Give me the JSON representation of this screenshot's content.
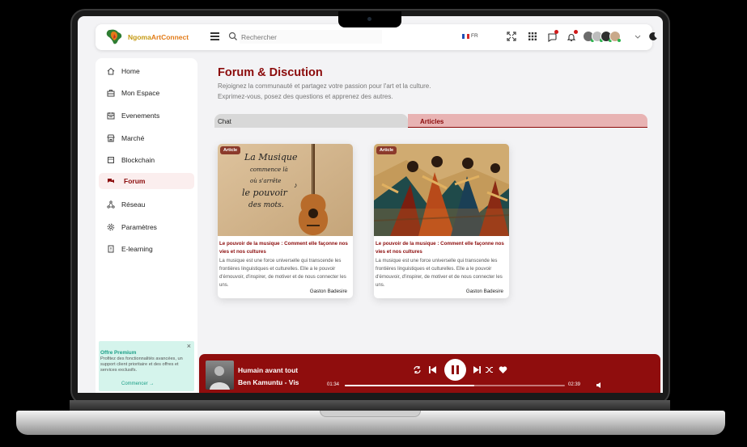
{
  "header": {
    "brand_part1": "Ngoma",
    "brand_part2": "ArtConnect",
    "search_placeholder": "Rechercher",
    "language": "FR"
  },
  "sidebar": {
    "items": [
      {
        "label": "Home",
        "icon": "home-icon"
      },
      {
        "label": "Mon Espace",
        "icon": "briefcase-icon"
      },
      {
        "label": "Evenements",
        "icon": "calendar-icon"
      },
      {
        "label": "Marché",
        "icon": "store-icon"
      },
      {
        "label": "Blockchain",
        "icon": "cube-icon"
      },
      {
        "label": "Forum",
        "icon": "chat-bubbles-icon"
      },
      {
        "label": "Réseau",
        "icon": "network-icon"
      },
      {
        "label": "Paramètres",
        "icon": "gear-icon"
      },
      {
        "label": "E-learning",
        "icon": "book-icon"
      }
    ],
    "active": "Forum",
    "premium": {
      "title": "Offre Premium",
      "description": "Profitez des fonctionnalités avancées, un support client prioritaire et des offres et services exclusifs.",
      "cta": "Commencer →"
    }
  },
  "main": {
    "title": "Forum & Discution",
    "subtitle_line1": "Rejoignez la communauté et partagez votre passion pour l'art et la culture.",
    "subtitle_line2": "Exprimez-vous, posez des questions et apprenez des autres.",
    "tabs": [
      {
        "label": "Chat"
      },
      {
        "label": "Articles"
      }
    ],
    "active_tab": "Articles",
    "cards": [
      {
        "tag": "Article",
        "title": "Le pouvoir de la musique : Comment elle façonne nos vies et nos cultures",
        "excerpt": "La musique est une force universelle qui transcende les frontières linguistiques et culturelles. Elle a le pouvoir d'émouvoir, d'inspirer, de motiver et de nous connecter les uns.",
        "author": "Gaston Badesire",
        "image_text": [
          "La Musique",
          "commence là",
          "où s'arrête",
          "le pouvoir",
          "des mots."
        ]
      },
      {
        "tag": "Article",
        "title": "Le pouvoir de la musique : Comment elle façonne nos vies et nos cultures",
        "excerpt": "La musique est une force universelle qui transcende les frontières linguistiques et culturelles. Elle a le pouvoir d'émouvoir, d'inspirer, de motiver et de nous connecter les uns.",
        "author": "Gaston Badesire"
      }
    ]
  },
  "player": {
    "track": "Humain avant tout",
    "artist": "Ben Kamuntu - Vis",
    "current_time": "01:34",
    "duration": "02:39",
    "progress": 0.59
  },
  "colors": {
    "accent": "#8b0b0b",
    "player_bg": "#8f0d0d",
    "premium_bg": "#d5f4ec",
    "premium_text": "#1a9e86"
  }
}
